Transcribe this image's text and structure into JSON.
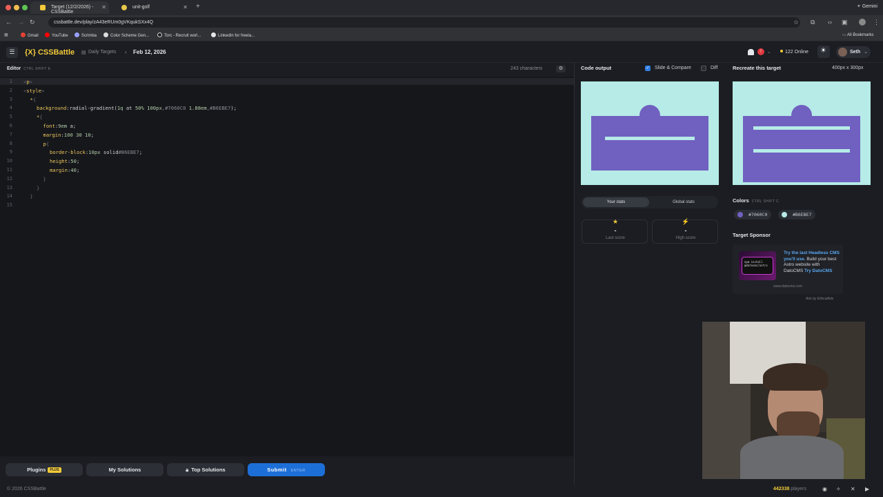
{
  "browser": {
    "tabs": [
      {
        "title": "Target (12/2/2026) - CSSBattle",
        "active": true
      },
      {
        "title": "unit-golf",
        "active": false
      }
    ],
    "new_tab": "+",
    "profile_label": "Gemini",
    "url": "cssbattle.dev/play/zA43eRUm0gVKqukSXx4Q",
    "bookmarks": [
      "Gmail",
      "YouTube",
      "Scrimba",
      "Color Scheme Gen...",
      "Torc - Recruit worl...",
      "LinkedIn for freela..."
    ],
    "all_bookmarks": "All Bookmarks"
  },
  "header": {
    "logo": "{X} CSSBattle",
    "breadcrumb_section": "Daily Targets",
    "breadcrumb_current": "Feb 12, 2026",
    "notification_count": "!",
    "online": "122 Online",
    "user": "Seth"
  },
  "editor": {
    "title": "Editor",
    "shortcut": "CTRL SHIFT E",
    "characters": "243 characters",
    "gear": "⚙",
    "lines": [
      {
        "n": "1",
        "indent": 0,
        "parts": [
          [
            "t",
            "<"
          ],
          [
            "p",
            "p"
          ],
          [
            "t",
            ">"
          ]
        ]
      },
      {
        "n": "2",
        "indent": 0,
        "parts": [
          [
            "t",
            "<"
          ],
          [
            "p",
            "style"
          ],
          [
            "t",
            ">"
          ]
        ]
      },
      {
        "n": "3",
        "indent": 1,
        "parts": [
          [
            "p",
            "*"
          ],
          [
            "t",
            "{"
          ]
        ]
      },
      {
        "n": "4",
        "indent": 2,
        "parts": [
          [
            "p",
            "background"
          ],
          [
            "",
            ":radial-gradient("
          ],
          [
            "v",
            "1q"
          ],
          [
            "",
            " at "
          ],
          [
            "v",
            "50%"
          ],
          [
            "",
            " "
          ],
          [
            "v",
            "100px"
          ],
          [
            "c",
            ",#7060C0"
          ],
          [
            "",
            " "
          ],
          [
            "v",
            "1.88em"
          ],
          [
            "c",
            ",#B6EBE7"
          ],
          [
            "",
            ");"
          ]
        ]
      },
      {
        "n": "5",
        "indent": 2,
        "parts": [
          [
            "p",
            "*"
          ],
          [
            "t",
            "{"
          ]
        ]
      },
      {
        "n": "6",
        "indent": 3,
        "parts": [
          [
            "p",
            "font"
          ],
          [
            "",
            ":"
          ],
          [
            "v",
            "9em"
          ],
          [
            "",
            " a;"
          ]
        ]
      },
      {
        "n": "7",
        "indent": 3,
        "parts": [
          [
            "p",
            "margin"
          ],
          [
            "",
            ":"
          ],
          [
            "v",
            "100"
          ],
          [
            "",
            " "
          ],
          [
            "v",
            "30"
          ],
          [
            "",
            " "
          ],
          [
            "v",
            "10"
          ],
          [
            "",
            ";"
          ]
        ]
      },
      {
        "n": "8",
        "indent": 3,
        "parts": [
          [
            "p",
            "p"
          ],
          [
            "t",
            "{"
          ]
        ]
      },
      {
        "n": "9",
        "indent": 4,
        "parts": [
          [
            "p",
            "border-block"
          ],
          [
            "",
            ":"
          ],
          [
            "v",
            "10px"
          ],
          [
            "",
            " solid"
          ],
          [
            "c",
            "#B6EBE7"
          ],
          [
            "",
            ";"
          ]
        ]
      },
      {
        "n": "10",
        "indent": 4,
        "parts": [
          [
            "p",
            "height"
          ],
          [
            "",
            ":"
          ],
          [
            "v",
            "50"
          ],
          [
            "",
            ";"
          ]
        ]
      },
      {
        "n": "11",
        "indent": 4,
        "parts": [
          [
            "p",
            "margin"
          ],
          [
            "",
            ":"
          ],
          [
            "v",
            "40"
          ],
          [
            "",
            ";"
          ]
        ]
      },
      {
        "n": "12",
        "indent": 3,
        "parts": [
          [
            "t",
            "}"
          ]
        ]
      },
      {
        "n": "13",
        "indent": 2,
        "parts": [
          [
            "t",
            "}"
          ]
        ]
      },
      {
        "n": "14",
        "indent": 1,
        "parts": [
          [
            "t",
            "}"
          ]
        ]
      },
      {
        "n": "15",
        "indent": 0,
        "parts": []
      }
    ]
  },
  "buttons": {
    "plugins": "Plugins",
    "plugins_badge": "PLUS",
    "my_solutions": "My Solutions",
    "top_solutions": "Top Solutions",
    "submit": "Submit",
    "submit_hint": "ENTER"
  },
  "output": {
    "title": "Code output",
    "slide_compare": "Slide & Compare",
    "slide_compare_checked": true,
    "diff": "Diff",
    "diff_checked": false
  },
  "target": {
    "title": "Recreate this target",
    "dims": "400px x 300px"
  },
  "stats": {
    "tab_yours": "Your stats",
    "tab_global": "Global stats",
    "last_score_icon": "★",
    "last_score_value": "-",
    "last_score_label": "Last score",
    "high_score_icon": "⚡",
    "high_score_value": "-",
    "high_score_label": "High score"
  },
  "colors": {
    "title": "Colors",
    "shortcut": "CTRL SHIFT C",
    "swatches": [
      {
        "hex": "#7060C0"
      },
      {
        "hex": "#B6EBE7"
      }
    ]
  },
  "sponsor": {
    "title": "Target Sponsor",
    "code_snippet": "npm install @datocms/astro",
    "text_lead": "Try the last Headless CMS you'll use.",
    "text_body": " Build your best Astro website with DatoCMS ",
    "text_cta": "Try DatoCMS",
    "domain": "www.datocms.com",
    "ads_by": "Ads by EthicalAds"
  },
  "footer": {
    "copyright": "© 2026 CSSBattle",
    "players_count": "442338",
    "players_label": " players"
  }
}
